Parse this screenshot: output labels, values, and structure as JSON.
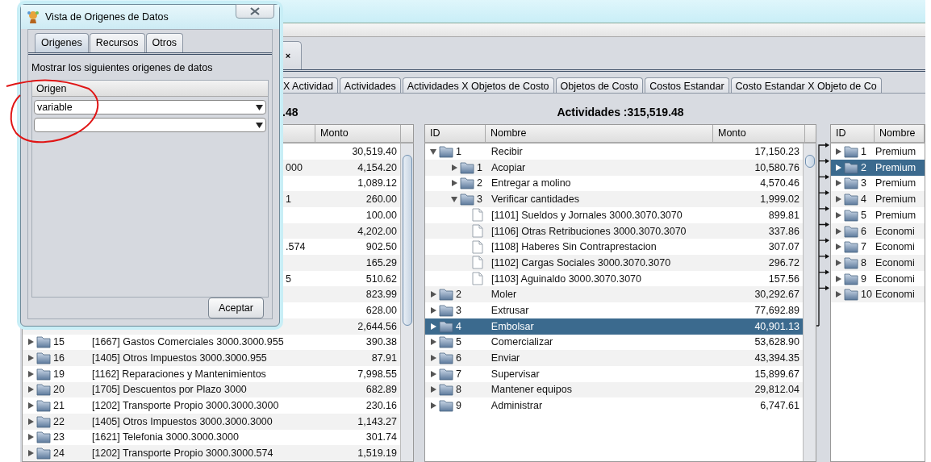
{
  "dialog": {
    "title": "Vista de Origenes de Datos",
    "tabs": [
      {
        "label": "Origenes",
        "selected": true
      },
      {
        "label": "Recursos",
        "selected": false
      },
      {
        "label": "Otros",
        "selected": false
      }
    ],
    "caption": "Mostrar los siguientes origenes de datos",
    "column": "Origen",
    "dropdowns": [
      {
        "kind": "value",
        "value": "variable"
      },
      {
        "kind": "blank"
      }
    ],
    "button": "Aceptar"
  },
  "main": {
    "doc_tab": {
      "close": "×"
    },
    "tabs": [
      {
        "label": "X Actividad",
        "selected": false
      },
      {
        "label": "Actividades",
        "selected": false
      },
      {
        "label": "Actividades X Objetos de Costo",
        "selected": false
      },
      {
        "label": "Objetos de Costo",
        "selected": false
      },
      {
        "label": "Costos Estandar",
        "selected": false
      },
      {
        "label": "Costo Estandar X Objeto de Co",
        "selected": false
      }
    ],
    "left_panel": {
      "total": ".48",
      "column": "Monto",
      "rows": [
        {
          "monto": "30,519.40"
        },
        {
          "name_tail": "000",
          "monto": "4,154.20"
        },
        {
          "monto": "1,089.12"
        },
        {
          "name_tail": "1",
          "monto": "260.00"
        },
        {
          "monto": "100.00"
        },
        {
          "monto": "4,202.00"
        },
        {
          "name_tail": ".574",
          "monto": "902.50"
        },
        {
          "monto": "165.29"
        },
        {
          "name_tail": "5",
          "monto": "510.62"
        },
        {
          "monto": "823.99"
        },
        {
          "monto": "628.00"
        },
        {
          "monto": "2,644.56"
        },
        {
          "id": "15",
          "name": "[1667] Gastos Comerciales 3000.3000.955",
          "monto": "390.38"
        },
        {
          "id": "16",
          "name": "[1405] Otros Impuestos 3000.3000.955",
          "monto": "87.91"
        },
        {
          "id": "19",
          "name": "[1162] Reparaciones y Mantenimientos",
          "monto": "7,998.55"
        },
        {
          "id": "20",
          "name": "[1705] Descuentos por Plazo 3000",
          "monto": "682.89"
        },
        {
          "id": "21",
          "name": "[1202] Transporte Propio 3000.3000.3000",
          "monto": "230.16"
        },
        {
          "id": "22",
          "name": "[1405] Otros Impuestos 3000.3000.3000",
          "monto": "1,143.27"
        },
        {
          "id": "23",
          "name": "[1621] Telefonia 3000.3000.3000",
          "monto": "301.74"
        },
        {
          "id": "24",
          "name": "[1202] Transporte Propio 3000.3000.574",
          "monto": "1,519.19"
        }
      ]
    },
    "middle_panel": {
      "total": "Actividades :315,519.48",
      "columns": [
        "ID",
        "Nombre",
        "Monto"
      ],
      "rows": [
        {
          "kind": "folder",
          "id": "1",
          "name": "Recibir",
          "monto": "17,150.23",
          "expanded": true,
          "selected": false,
          "children": [
            {
              "kind": "folder",
              "id": "1",
              "name": "Acopiar",
              "monto": "10,580.76",
              "expanded": false,
              "selected": false
            },
            {
              "kind": "folder",
              "id": "2",
              "name": "Entregar a molino",
              "monto": "4,570.46",
              "expanded": false,
              "selected": false
            },
            {
              "kind": "folder",
              "id": "3",
              "name": "Verificar cantidades",
              "monto": "1,999.02",
              "expanded": true,
              "selected": false,
              "children": [
                {
                  "kind": "account",
                  "name": "[1101] Sueldos y Jornales 3000.3070.3070",
                  "monto": "899.81",
                  "selected": false
                },
                {
                  "kind": "account",
                  "name": "[1106] Otras Retribuciones 3000.3070.3070",
                  "monto": "337.86",
                  "selected": false
                },
                {
                  "kind": "account",
                  "name": "[1108] Haberes Sin Contraprestacion",
                  "monto": "307.07",
                  "selected": false
                },
                {
                  "kind": "account",
                  "name": "[1102] Cargas Sociales 3000.3070.3070",
                  "monto": "296.72",
                  "selected": false
                },
                {
                  "kind": "account",
                  "name": "[1103] Aguinaldo 3000.3070.3070",
                  "monto": "157.56",
                  "selected": false
                }
              ]
            }
          ]
        },
        {
          "kind": "folder",
          "id": "2",
          "name": "Moler",
          "monto": "30,292.67",
          "expanded": false,
          "selected": false
        },
        {
          "kind": "folder",
          "id": "3",
          "name": "Extrusar",
          "monto": "77,692.89",
          "expanded": false,
          "selected": false
        },
        {
          "kind": "folder",
          "id": "4",
          "name": "Embolsar",
          "monto": "40,901.13",
          "expanded": false,
          "selected": true
        },
        {
          "kind": "folder",
          "id": "5",
          "name": "Comercializar",
          "monto": "53,628.90",
          "expanded": false,
          "selected": false
        },
        {
          "kind": "folder",
          "id": "6",
          "name": "Enviar",
          "monto": "43,394.35",
          "expanded": false,
          "selected": false
        },
        {
          "kind": "folder",
          "id": "7",
          "name": "Supervisar",
          "monto": "15,899.67",
          "expanded": false,
          "selected": false
        },
        {
          "kind": "folder",
          "id": "8",
          "name": "Mantener equipos",
          "monto": "29,812.04",
          "expanded": false,
          "selected": false
        },
        {
          "kind": "folder",
          "id": "9",
          "name": "Administrar",
          "monto": "6,747.61",
          "expanded": false,
          "selected": false
        }
      ]
    },
    "right_panel": {
      "columns": [
        "ID",
        "Nombre"
      ],
      "rows": [
        {
          "id": "1",
          "name": "Premium",
          "selected": false
        },
        {
          "id": "2",
          "name": "Premium",
          "selected": true
        },
        {
          "id": "3",
          "name": "Premium",
          "selected": false
        },
        {
          "id": "4",
          "name": "Premium",
          "selected": false
        },
        {
          "id": "5",
          "name": "Premium",
          "selected": false
        },
        {
          "id": "6",
          "name": "Economi",
          "selected": false
        },
        {
          "id": "7",
          "name": "Economi",
          "selected": false
        },
        {
          "id": "8",
          "name": "Economi",
          "selected": false
        },
        {
          "id": "9",
          "name": "Economi",
          "selected": false
        },
        {
          "id": "10",
          "name": "Economi",
          "selected": false
        }
      ]
    }
  }
}
